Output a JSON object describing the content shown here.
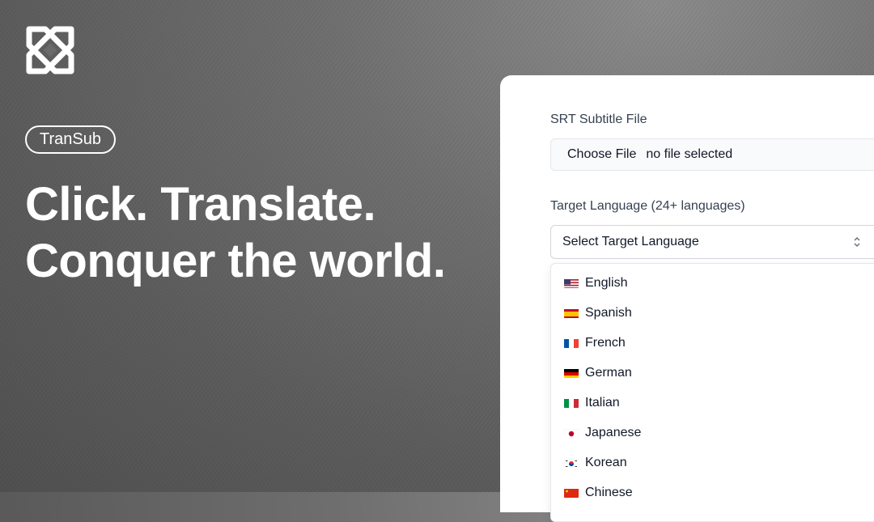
{
  "brand": {
    "badge": "TranSub"
  },
  "hero": {
    "line1": "Click. Translate.",
    "line2": "Conquer the world."
  },
  "form": {
    "file_label": "SRT Subtitle File",
    "choose_file": "Choose File",
    "file_status": "no file selected",
    "language_label": "Target Language (24+ languages)",
    "language_select": "Select Target Language"
  },
  "languages": [
    {
      "name": "English",
      "flag": "us-flag-icon"
    },
    {
      "name": "Spanish",
      "flag": "es-flag-icon"
    },
    {
      "name": "French",
      "flag": "fr-flag-icon"
    },
    {
      "name": "German",
      "flag": "de-flag-icon"
    },
    {
      "name": "Italian",
      "flag": "it-flag-icon"
    },
    {
      "name": "Japanese",
      "flag": "jp-flag-icon"
    },
    {
      "name": "Korean",
      "flag": "kr-flag-icon"
    },
    {
      "name": "Chinese",
      "flag": "cn-flag-icon"
    }
  ],
  "colors": {
    "panel_bg": "#ffffff",
    "label_text": "#374151",
    "border": "#e5e7eb"
  }
}
